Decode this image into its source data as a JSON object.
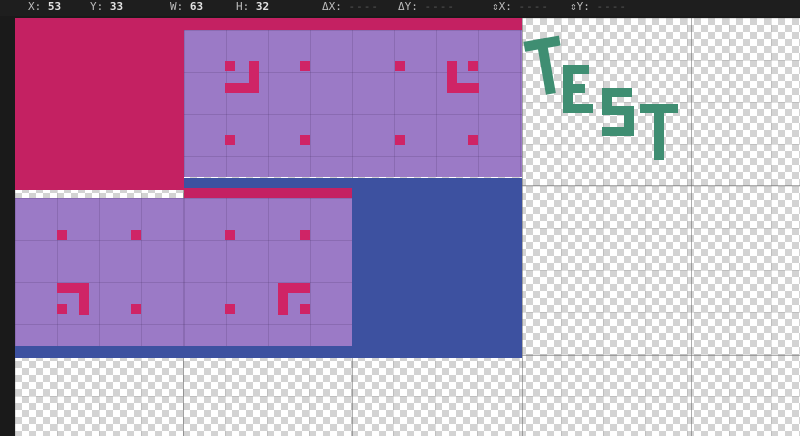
{
  "infobar": {
    "x_label": "X:",
    "x_value": "53",
    "y_label": "Y:",
    "y_value": "33",
    "w_label": "W:",
    "w_value": "63",
    "h_label": "H:",
    "h_value": "32",
    "dx_label": "ΔX:",
    "dx_value": "----",
    "dy_label": "ΔY:",
    "dy_value": "----",
    "ax_label": "⇕X:",
    "ax_value": "----",
    "ay_label": "⇕Y:",
    "ay_value": "----"
  },
  "canvas": {
    "text_art": "TEST"
  },
  "colors": {
    "crimson": "#c42162",
    "lavender": "#9b7ac6",
    "navy": "#3d51a0",
    "pink_mark": "#cf2466",
    "teal": "#3f8e72",
    "checker_light": "#ffffff",
    "checker_dark": "#d3d3d3",
    "background": "#1e1e1e"
  }
}
